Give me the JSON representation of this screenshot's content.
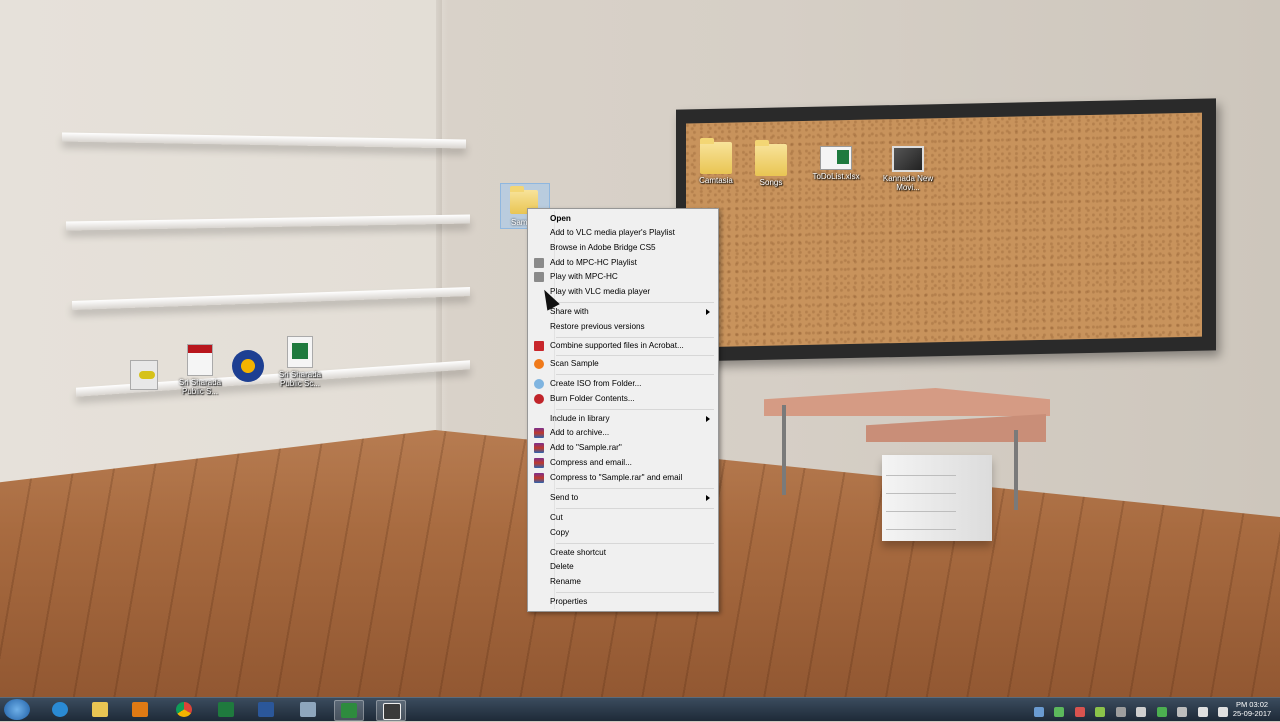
{
  "desktop": {
    "icons": [
      {
        "label": "Camtasia"
      },
      {
        "label": "Songs"
      },
      {
        "label": "ToDoList.xlsx"
      },
      {
        "label": "Kannada New Movi..."
      },
      {
        "label": "Sri Sharada Public S..."
      },
      {
        "label": "Sri Sharada Public Sc..."
      },
      {
        "label": "Sam..."
      }
    ]
  },
  "context_menu": {
    "items": [
      {
        "label": "Open",
        "bold": true
      },
      {
        "label": "Add to VLC media player's Playlist"
      },
      {
        "label": "Browse in Adobe Bridge CS5"
      },
      {
        "label": "Add to MPC-HC Playlist"
      },
      {
        "label": "Play with MPC-HC"
      },
      {
        "label": "Play with VLC media player"
      },
      {
        "label": "Share with",
        "submenu": true
      },
      {
        "label": "Restore previous versions"
      },
      {
        "label": "Combine supported files in Acrobat..."
      },
      {
        "label": "Scan Sample"
      },
      {
        "label": "Create ISO from Folder..."
      },
      {
        "label": "Burn Folder Contents..."
      },
      {
        "label": "Include in library",
        "submenu": true
      },
      {
        "label": "Add to archive..."
      },
      {
        "label": "Add to \"Sample.rar\""
      },
      {
        "label": "Compress and email..."
      },
      {
        "label": "Compress to \"Sample.rar\" and email"
      },
      {
        "label": "Send to",
        "submenu": true
      },
      {
        "label": "Cut"
      },
      {
        "label": "Copy"
      },
      {
        "label": "Create shortcut"
      },
      {
        "label": "Delete"
      },
      {
        "label": "Rename"
      },
      {
        "label": "Properties"
      }
    ]
  },
  "taskbar": {
    "clock_time": "PM 03:02",
    "clock_date": "25-09-2017"
  },
  "icons": {
    "menu_mpc": "mpc-icon",
    "menu_acrobat": "acrobat-icon",
    "menu_scan": "avast-scan-icon",
    "menu_iso": "iso-icon",
    "menu_burn": "burn-icon",
    "menu_winrar": "winrar-icon"
  },
  "colors": {
    "menu_bg": "#f0f0f0",
    "taskbar": "#1e2a38",
    "selection": "#a0c8f0"
  }
}
